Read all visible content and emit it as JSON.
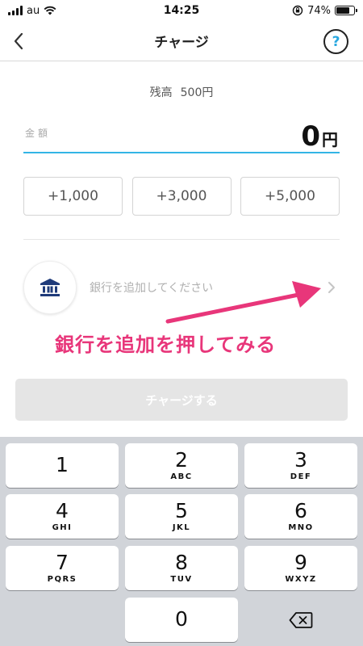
{
  "status_bar": {
    "carrier": "au",
    "time": "14:25",
    "battery": "74%",
    "battery_level": 0.74
  },
  "nav": {
    "title": "チャージ",
    "help": "?"
  },
  "balance": {
    "label": "残高",
    "value": "500円"
  },
  "amount": {
    "label": "金額",
    "value": "0",
    "unit": "円"
  },
  "quick_add": [
    "+1,000",
    "+3,000",
    "+5,000"
  ],
  "bank": {
    "placeholder": "銀行を追加してください"
  },
  "annotation": {
    "text": "銀行を追加を押してみる",
    "color": "#e8367a"
  },
  "charge_button": {
    "label": "チャージする"
  },
  "keypad": {
    "keys": [
      {
        "num": "1",
        "letters": ""
      },
      {
        "num": "2",
        "letters": "ABC"
      },
      {
        "num": "3",
        "letters": "DEF"
      },
      {
        "num": "4",
        "letters": "GHI"
      },
      {
        "num": "5",
        "letters": "JKL"
      },
      {
        "num": "6",
        "letters": "MNO"
      },
      {
        "num": "7",
        "letters": "PQRS"
      },
      {
        "num": "8",
        "letters": "TUV"
      },
      {
        "num": "9",
        "letters": "WXYZ"
      },
      {
        "num": "0",
        "letters": ""
      }
    ]
  },
  "colors": {
    "accent": "#33b5e5",
    "help_mark": "#29a8e0",
    "bank_icon": "#1f3b7a",
    "keypad_bg": "#d1d4d9"
  },
  "icons": [
    "back-chevron-icon",
    "help-icon",
    "bank-icon",
    "chevron-right-icon",
    "delete-key-icon",
    "wifi-icon",
    "signal-icon",
    "battery-icon",
    "rotation-lock-icon"
  ]
}
